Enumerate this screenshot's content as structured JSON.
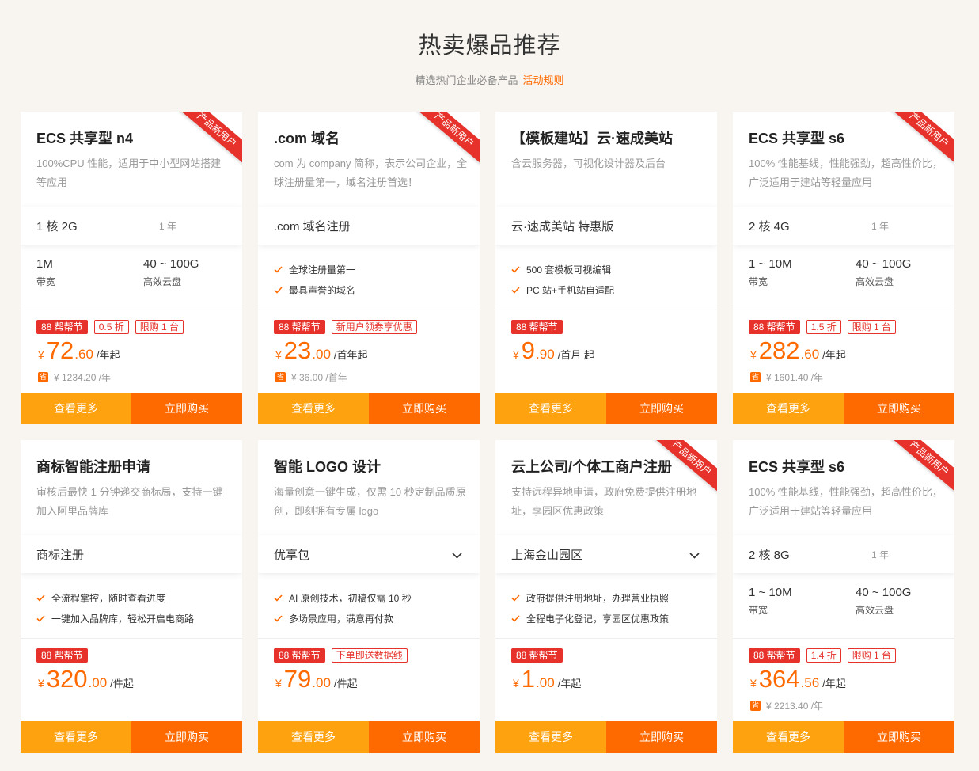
{
  "header": {
    "title": "热卖爆品推荐",
    "subtitle": "精选热门企业必备产品",
    "rules_link": "活动规则"
  },
  "colors": {
    "accent": "#ff6a00",
    "button_more": "#ffa20f",
    "tag_red": "#e6322a",
    "background": "#f8f4ef"
  },
  "products": [
    {
      "ribbon": "产品新用户",
      "title": "ECS 共享型 n4",
      "desc": "100%CPU 性能，适用于中小型网站搭建等应用",
      "spec": "1 核 2G",
      "period": "1 年",
      "metrics": [
        {
          "value": "1M",
          "label": "带宽"
        },
        {
          "value": "40 ~ 100G",
          "label": "高效云盘"
        }
      ],
      "tags": [
        "88 帮帮节",
        "0.5 折",
        "限购 1 台"
      ],
      "price": {
        "currency": "¥",
        "int": "72",
        "dec": ".60",
        "unit": "/年起"
      },
      "original": "¥ 1234.20 /年",
      "save_icon": "省",
      "btn_more": "查看更多",
      "btn_buy": "立即购买"
    },
    {
      "ribbon": "产品新用户",
      "title": ".com 域名",
      "desc": "com 为 company 简称，表示公司企业，全球注册量第一，域名注册首选！",
      "spec": ".com 域名注册",
      "features": [
        "全球注册量第一",
        "最具声誉的域名"
      ],
      "tags": [
        "88 帮帮节",
        "新用户领券享优惠"
      ],
      "price": {
        "currency": "¥",
        "int": "23",
        "dec": ".00",
        "unit": "/首年起"
      },
      "original": "¥ 36.00 /首年",
      "save_icon": "省",
      "btn_more": "查看更多",
      "btn_buy": "立即购买"
    },
    {
      "title": "【模板建站】云·速成美站",
      "desc": "含云服务器，可视化设计器及后台",
      "spec": "云·速成美站 特惠版",
      "features": [
        "500 套模板可视编辑",
        "PC 站+手机站自适配"
      ],
      "tags": [
        "88 帮帮节"
      ],
      "price": {
        "currency": "¥",
        "int": "9",
        "dec": ".90",
        "unit": "/首月 起"
      },
      "btn_more": "查看更多",
      "btn_buy": "立即购买"
    },
    {
      "ribbon": "产品新用户",
      "title": "ECS 共享型 s6",
      "desc": "100% 性能基线，性能强劲，超高性价比，广泛适用于建站等轻量应用",
      "spec": "2 核 4G",
      "period": "1 年",
      "metrics": [
        {
          "value": "1 ~ 10M",
          "label": "带宽"
        },
        {
          "value": "40 ~ 100G",
          "label": "高效云盘"
        }
      ],
      "tags": [
        "88 帮帮节",
        "1.5 折",
        "限购 1 台"
      ],
      "price": {
        "currency": "¥",
        "int": "282",
        "dec": ".60",
        "unit": "/年起"
      },
      "original": "¥ 1601.40 /年",
      "save_icon": "省",
      "btn_more": "查看更多",
      "btn_buy": "立即购买"
    },
    {
      "title": "商标智能注册申请",
      "desc": "审核后最快 1 分钟递交商标局，支持一键加入阿里品牌库",
      "spec": "商标注册",
      "features": [
        "全流程掌控，随时查看进度",
        "一键加入品牌库，轻松开启电商路"
      ],
      "tags": [
        "88 帮帮节"
      ],
      "price": {
        "currency": "¥",
        "int": "320",
        "dec": ".00",
        "unit": "/件起"
      },
      "btn_more": "查看更多",
      "btn_buy": "立即购买"
    },
    {
      "title": "智能 LOGO 设计",
      "desc": "海量创意一键生成，仅需 10 秒定制品质原创，即刻拥有专属 logo",
      "spec": "优享包",
      "dropdown": true,
      "features": [
        "AI 原创技术，初稿仅需 10 秒",
        "多场景应用，满意再付款"
      ],
      "tags": [
        "88 帮帮节",
        "下单即送数据线"
      ],
      "price": {
        "currency": "¥",
        "int": "79",
        "dec": ".00",
        "unit": "/件起"
      },
      "btn_more": "查看更多",
      "btn_buy": "立即购买"
    },
    {
      "ribbon": "产品新用户",
      "title": "云上公司/个体工商户注册",
      "desc": "支持远程异地申请，政府免费提供注册地址，享园区优惠政策",
      "spec": "上海金山园区",
      "dropdown": true,
      "features": [
        "政府提供注册地址，办理营业执照",
        "全程电子化登记，享园区优惠政策"
      ],
      "tags": [
        "88 帮帮节"
      ],
      "price": {
        "currency": "¥",
        "int": "1",
        "dec": ".00",
        "unit": "/年起"
      },
      "btn_more": "查看更多",
      "btn_buy": "立即购买"
    },
    {
      "ribbon": "产品新用户",
      "title": "ECS 共享型 s6",
      "desc": "100% 性能基线，性能强劲，超高性价比，广泛适用于建站等轻量应用",
      "spec": "2 核 8G",
      "period": "1 年",
      "metrics": [
        {
          "value": "1 ~ 10M",
          "label": "带宽"
        },
        {
          "value": "40 ~ 100G",
          "label": "高效云盘"
        }
      ],
      "tags": [
        "88 帮帮节",
        "1.4 折",
        "限购 1 台"
      ],
      "price": {
        "currency": "¥",
        "int": "364",
        "dec": ".56",
        "unit": "/年起"
      },
      "original": "¥ 2213.40 /年",
      "save_icon": "省",
      "btn_more": "查看更多",
      "btn_buy": "立即购买"
    }
  ]
}
